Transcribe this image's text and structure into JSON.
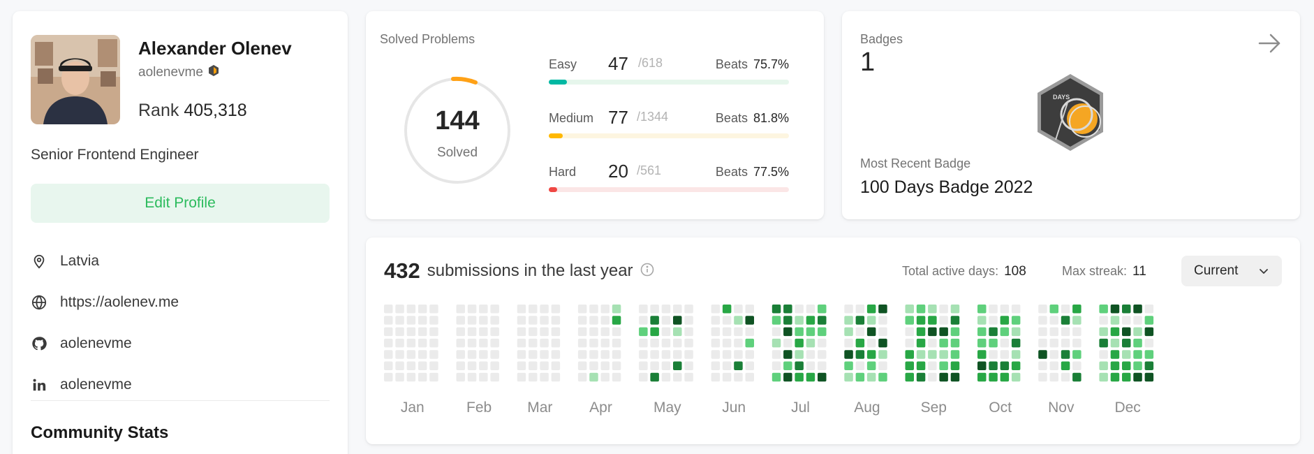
{
  "profile": {
    "name": "Alexander Olenev",
    "handle": "aolenevme",
    "rank_label": "Rank",
    "rank_value": "405,318",
    "job_title": "Senior Frontend Engineer",
    "edit_button": "Edit Profile",
    "location": "Latvia",
    "website": "https://aolenev.me",
    "github": "aolenevme",
    "linkedin": "aolenevme",
    "community_title": "Community Stats"
  },
  "solved": {
    "title": "Solved Problems",
    "total": "144",
    "total_label": "Solved",
    "beats_label": "Beats",
    "difficulties": [
      {
        "name": "Easy",
        "solved": "47",
        "total": "/618",
        "beats": "75.7%",
        "fraction": 0.076,
        "color": "#00b8a3",
        "track": "#e6f6ec"
      },
      {
        "name": "Medium",
        "solved": "77",
        "total": "/1344",
        "beats": "81.8%",
        "fraction": 0.057,
        "color": "#ffb800",
        "track": "#fdf5e0"
      },
      {
        "name": "Hard",
        "solved": "20",
        "total": "/561",
        "beats": "77.5%",
        "fraction": 0.036,
        "color": "#ef4743",
        "track": "#fbe6e6"
      }
    ]
  },
  "badges": {
    "title": "Badges",
    "count": "1",
    "badge_icon_text": "DAYS",
    "recent_label": "Most Recent Badge",
    "recent_name": "100 Days Badge 2022"
  },
  "submissions": {
    "count": "432",
    "text": "submissions in the last year",
    "active_days_label": "Total active days:",
    "active_days": "108",
    "max_streak_label": "Max streak:",
    "max_streak": "11",
    "period_select": "Current",
    "months": [
      "Jan",
      "Feb",
      "Mar",
      "Apr",
      "May",
      "Jun",
      "Jul",
      "Aug",
      "Sep",
      "Oct",
      "Nov",
      "Dec"
    ]
  },
  "colors": {
    "accent": "#2cbb5d",
    "heat_empty": "#ebebeb",
    "heat_levels": [
      "#a6e1b3",
      "#5fd07c",
      "#28a745",
      "#1a7f37",
      "#0f5323"
    ]
  }
}
